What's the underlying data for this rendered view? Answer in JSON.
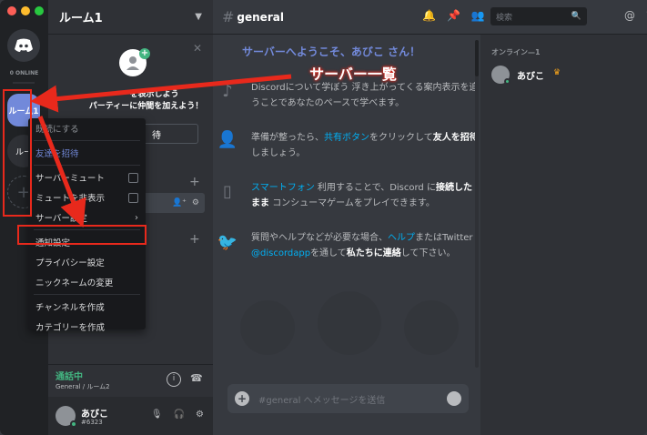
{
  "app": {
    "server_name": "ルーム1"
  },
  "guilds": {
    "online_label": "0 ONLINE",
    "room_abbr": "ルーム1",
    "room2_abbr": "ルー",
    "add": "+"
  },
  "invite": {
    "close": "✕",
    "text": "ーーを表示しよう\nパーティーに仲間を加えよう！",
    "button": "待"
  },
  "channels": {
    "voice_status": "通話中",
    "voice_sub": "General / ルーム2"
  },
  "user": {
    "name": "あびこ",
    "tag": "#6323"
  },
  "context_menu": {
    "items": [
      "既読にする",
      "友達を招待",
      "サーバーミュート",
      "ミュートを非表示",
      "サーバー設定",
      "通知設定",
      "プライバシー設定",
      "ニックネームの変更",
      "チャンネルを作成",
      "カテゴリーを作成"
    ]
  },
  "header": {
    "channel": "general",
    "search_placeholder": "検索"
  },
  "welcome": {
    "title": "サーバーへようこそ、あびこ さん！",
    "tip1": "Discordについて学ぼう 浮き上がってくる案内表示を追うことであなたのペースで学べます。",
    "tip2_a": "準備が整ったら、",
    "tip2_link": "共有ボタン",
    "tip2_b": "をクリックして",
    "tip2_strong": "友人を招待",
    "tip2_c": "しましょう。",
    "tip3_link": "スマートフォン",
    "tip3_a": "利用することで、Discord に",
    "tip3_strong": "接続したまま",
    "tip3_b": "コンシューマゲームをプレイできます。",
    "tip4_a": "質問やヘルプなどが必要な場合、",
    "tip4_link": "ヘルプ",
    "tip4_b": "またはTwitter",
    "tip4_twitter": "@discordapp",
    "tip4_c": "を通して",
    "tip4_strong": "私たちに連絡",
    "tip4_d": "して下さい。"
  },
  "message_input": {
    "placeholder": "#general へメッセージを送信"
  },
  "members": {
    "category": "オンライン—1",
    "name": "あびこ"
  },
  "annotation": {
    "label": "サーバー一覧"
  },
  "colors": {
    "accent": "#7289da",
    "online": "#43b581",
    "annotation_red": "#e8291c",
    "link": "#00b0f4"
  }
}
